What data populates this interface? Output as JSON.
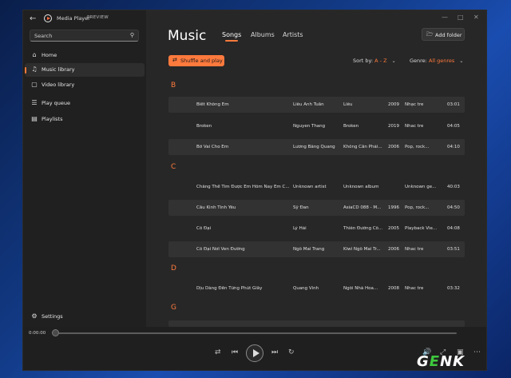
{
  "app": {
    "title": "Media Player",
    "badge": "PREVIEW"
  },
  "search": {
    "placeholder": "Search"
  },
  "sidebar": {
    "items": [
      {
        "label": "Home",
        "icon": "home-icon"
      },
      {
        "label": "Music library",
        "icon": "music-note-icon",
        "active": true
      },
      {
        "label": "Video library",
        "icon": "video-icon"
      },
      {
        "label": "Play queue",
        "icon": "queue-icon"
      },
      {
        "label": "Playlists",
        "icon": "playlist-icon"
      },
      {
        "label": "Settings",
        "icon": "gear-icon"
      }
    ]
  },
  "main": {
    "heading": "Music",
    "tabs": [
      {
        "label": "Songs",
        "active": true
      },
      {
        "label": "Albums"
      },
      {
        "label": "Artists"
      }
    ],
    "add_folder": "Add folder",
    "shuffle": "Shuffle and play",
    "sort": {
      "label": "Sort by:",
      "value": "A - Z"
    },
    "genre": {
      "label": "Genre:",
      "value": "All genres"
    }
  },
  "groups": [
    {
      "letter": "B",
      "songs": [
        {
          "title": "Biết Không Em",
          "artist": "Liêu Anh Tuấn",
          "album": "Liêu",
          "year": "2009",
          "genre": "Nhạc tre",
          "duration": "03:01"
        },
        {
          "title": "Broken",
          "artist": "Nguyen Thang",
          "album": "Broken",
          "year": "2019",
          "genre": "Nhac tre",
          "duration": "04:05"
        },
        {
          "title": "Bờ Vai Cho Em",
          "artist": "Lương Bằng Quang",
          "album": "Không Cân Phải...",
          "year": "2006",
          "genre": "Pop, rock...",
          "duration": "04:10"
        }
      ]
    },
    {
      "letter": "C",
      "songs": [
        {
          "title": "Chẳng Thể Tìm Được Em Hôm Nay Em C...",
          "artist": "Unknown artist",
          "album": "Unknown album",
          "year": "",
          "genre": "Unknown ge...",
          "duration": "40:03"
        },
        {
          "title": "Câu Kinh Tình Yêu",
          "artist": "Sỹ Đan",
          "album": "AsiaCD 088 - M...",
          "year": "1996",
          "genre": "Pop, rock...",
          "duration": "04:50"
        },
        {
          "title": "Cô Đại",
          "artist": "Lý Hải",
          "album": "Thiên Đường Cô...",
          "year": "2005",
          "genre": "Playback Vie...",
          "duration": "04:08"
        },
        {
          "title": "Cô Đại Nơi Ven Đường",
          "artist": "Ngô Mai Trang",
          "album": "Kiwi Ngô Mai Tr...",
          "year": "2006",
          "genre": "Nhac tre",
          "duration": "03:51"
        }
      ]
    },
    {
      "letter": "D",
      "songs": [
        {
          "title": "Dịu Dàng Đến Từng Phút Giây",
          "artist": "Quang Vinh",
          "album": "Ngôi Nhà Hoa...",
          "year": "2008",
          "genre": "Nhac tre",
          "duration": "03:32"
        }
      ]
    },
    {
      "letter": "G",
      "songs": []
    }
  ],
  "player": {
    "time": "0:00:00",
    "progress": 0
  },
  "watermark": {
    "text": "GENK"
  }
}
